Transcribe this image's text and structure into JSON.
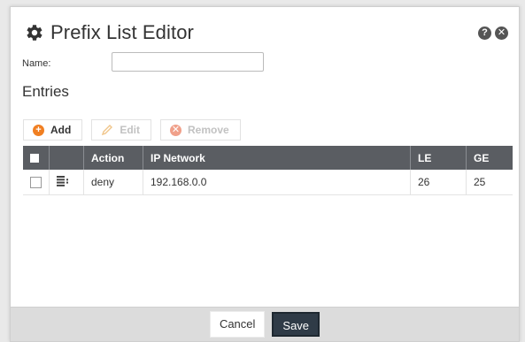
{
  "dialog": {
    "title": "Prefix List Editor",
    "help_icon": "question-icon",
    "close_icon": "close-icon",
    "title_icon": "gear-icon"
  },
  "form": {
    "name_label": "Name:",
    "name_value": "",
    "name_placeholder": ""
  },
  "entries": {
    "title": "Entries",
    "toolbar": {
      "add_label": "Add",
      "edit_label": "Edit",
      "remove_label": "Remove"
    },
    "columns": [
      "Action",
      "IP Network",
      "LE",
      "GE"
    ],
    "rows": [
      {
        "action": "deny",
        "ip_network": "192.168.0.0",
        "le": "26",
        "ge": "25"
      }
    ]
  },
  "footer": {
    "cancel_label": "Cancel",
    "save_label": "Save"
  },
  "colors": {
    "header_bg": "#5a5d62",
    "add_icon": "#f07f22",
    "remove_icon": "#f0a08a",
    "save_bg": "#2f3b47",
    "footer_bg": "#dcdcdc"
  }
}
